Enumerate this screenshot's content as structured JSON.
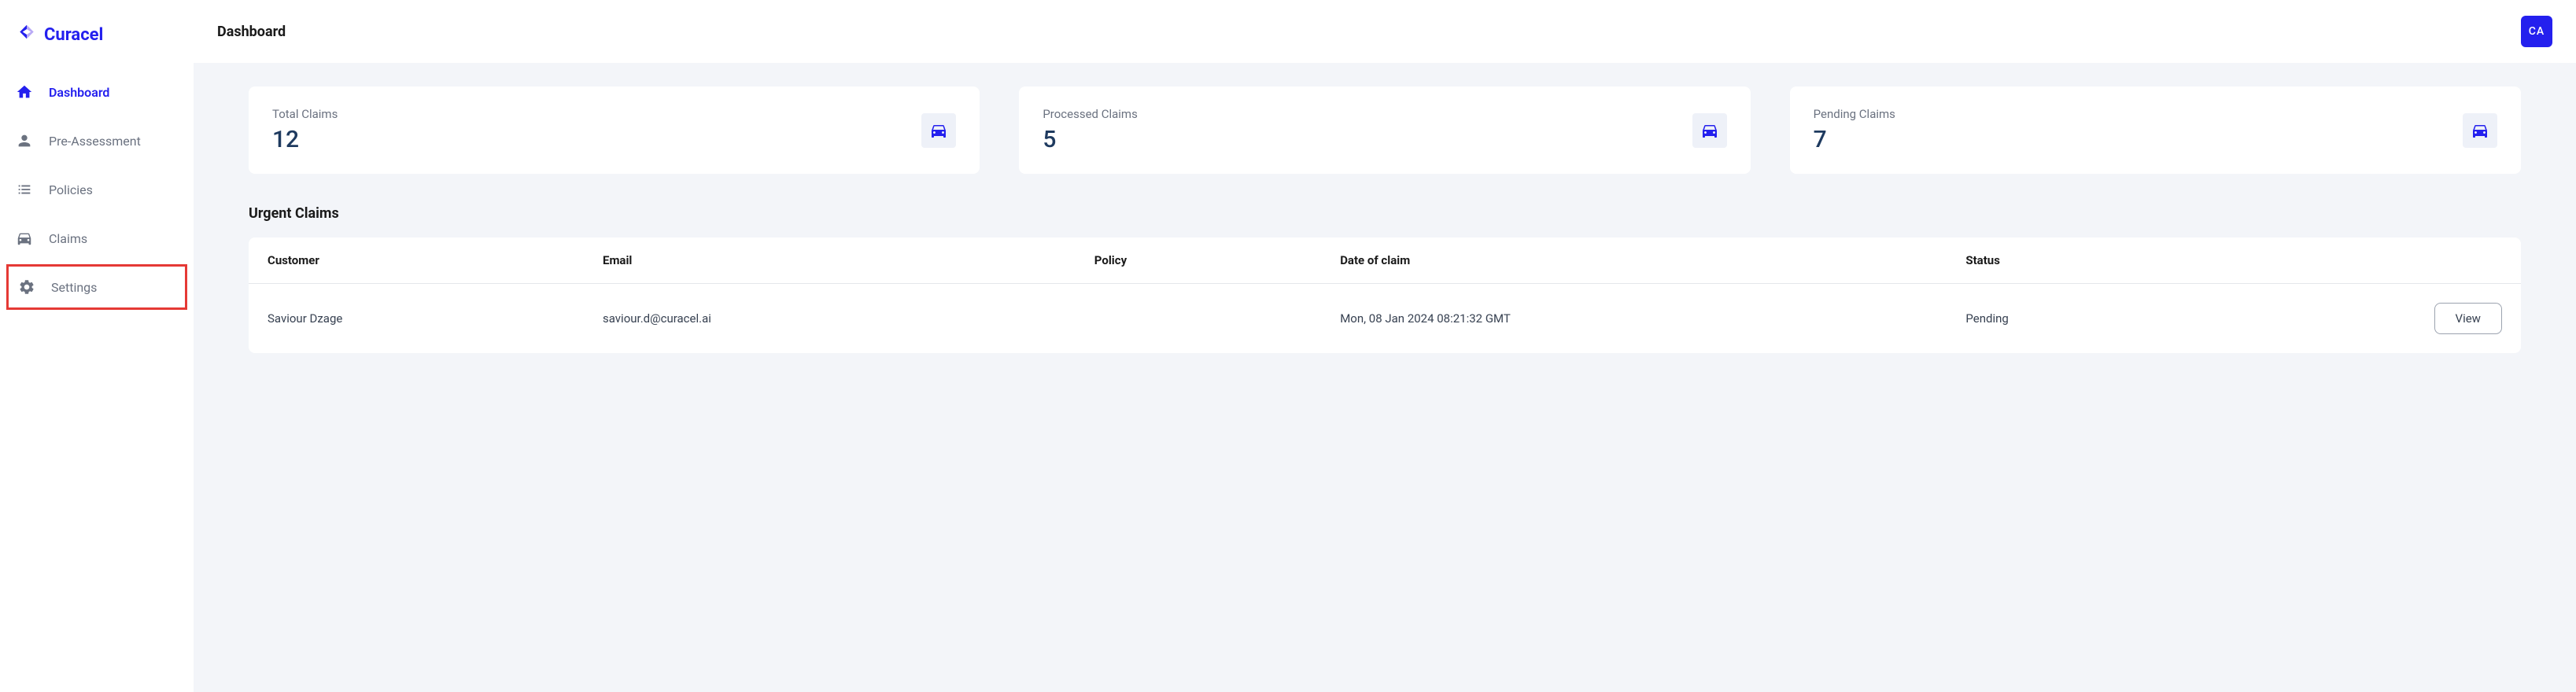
{
  "brand": {
    "name": "Curacel",
    "color_primary": "#2420ee"
  },
  "header": {
    "title": "Dashboard",
    "avatar_initials": "CA"
  },
  "sidebar": {
    "items": [
      {
        "label": "Dashboard",
        "icon": "home-icon",
        "active": true
      },
      {
        "label": "Pre-Assessment",
        "icon": "person-icon",
        "active": false
      },
      {
        "label": "Policies",
        "icon": "list-icon",
        "active": false
      },
      {
        "label": "Claims",
        "icon": "car-icon",
        "active": false
      },
      {
        "label": "Settings",
        "icon": "gear-icon",
        "active": false,
        "highlighted": true
      }
    ]
  },
  "stats": [
    {
      "label": "Total Claims",
      "value": "12"
    },
    {
      "label": "Processed Claims",
      "value": "5"
    },
    {
      "label": "Pending Claims",
      "value": "7"
    }
  ],
  "urgent_claims": {
    "title": "Urgent Claims",
    "columns": {
      "customer": "Customer",
      "email": "Email",
      "policy": "Policy",
      "date": "Date of claim",
      "status": "Status"
    },
    "rows": [
      {
        "customer": "Saviour Dzage",
        "email": "saviour.d@curacel.ai",
        "policy": "",
        "date": "Mon, 08 Jan 2024 08:21:32 GMT",
        "status": "Pending",
        "action": "View"
      }
    ]
  }
}
